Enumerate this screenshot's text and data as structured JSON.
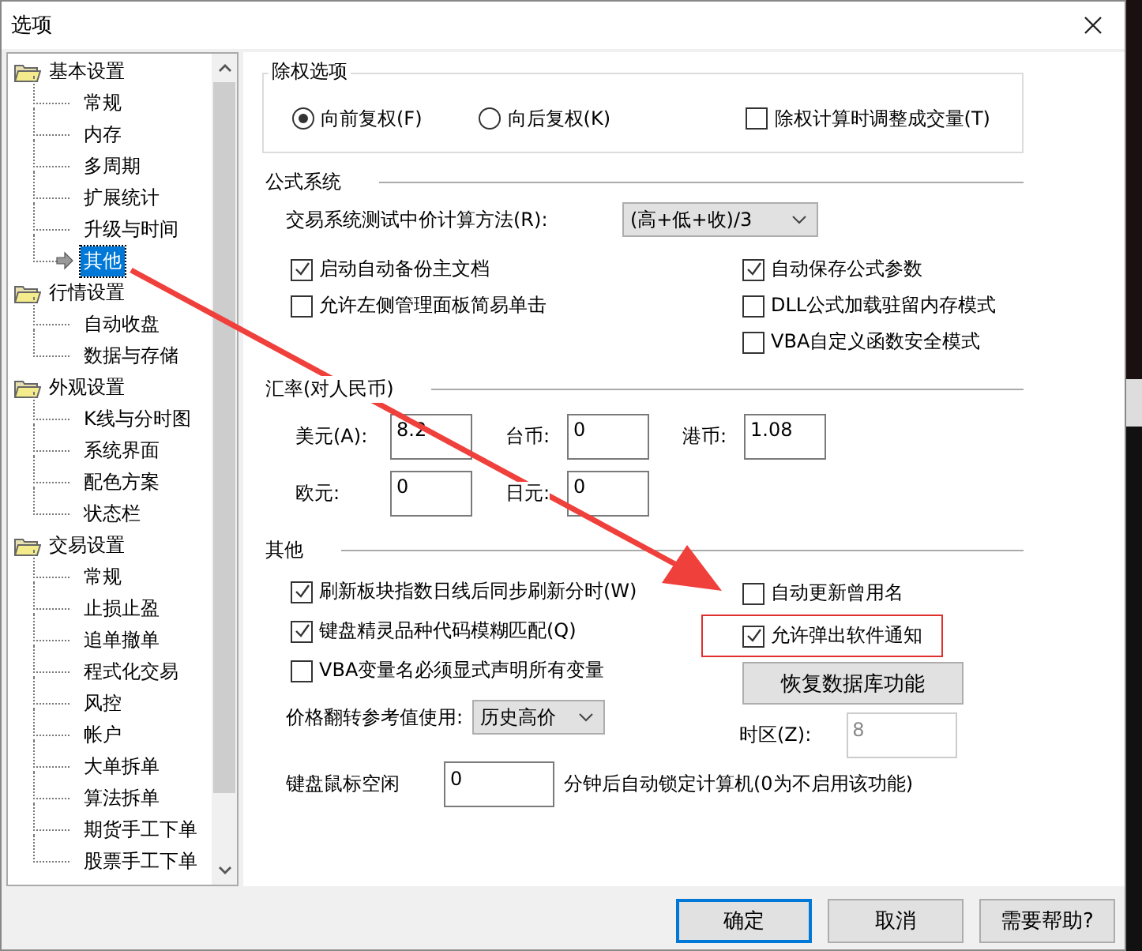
{
  "window": {
    "title": "选项"
  },
  "tree": [
    {
      "label": "基本设置",
      "expanded": true,
      "children": [
        {
          "label": "常规",
          "selected": false
        },
        {
          "label": "内存",
          "selected": false
        },
        {
          "label": "多周期",
          "selected": false
        },
        {
          "label": "扩展统计",
          "selected": false
        },
        {
          "label": "升级与时间",
          "selected": false
        },
        {
          "label": "其他",
          "selected": true
        }
      ]
    },
    {
      "label": "行情设置",
      "expanded": true,
      "children": [
        {
          "label": "自动收盘",
          "selected": false
        },
        {
          "label": "数据与存储",
          "selected": false
        }
      ]
    },
    {
      "label": "外观设置",
      "expanded": true,
      "children": [
        {
          "label": "K线与分时图",
          "selected": false
        },
        {
          "label": "系统界面",
          "selected": false
        },
        {
          "label": "配色方案",
          "selected": false
        },
        {
          "label": "状态栏",
          "selected": false
        }
      ]
    },
    {
      "label": "交易设置",
      "expanded": true,
      "children": [
        {
          "label": "常规",
          "selected": false
        },
        {
          "label": "止损止盈",
          "selected": false
        },
        {
          "label": "追单撤单",
          "selected": false
        },
        {
          "label": "程式化交易",
          "selected": false
        },
        {
          "label": "风控",
          "selected": false
        },
        {
          "label": "帐户",
          "selected": false
        },
        {
          "label": "大单拆单",
          "selected": false
        },
        {
          "label": "算法拆单",
          "selected": false
        },
        {
          "label": "期货手工下单",
          "selected": false
        },
        {
          "label": "股票手工下单",
          "selected": false
        }
      ]
    }
  ],
  "exright": {
    "title": "除权选项",
    "options": [
      {
        "kind": "radio",
        "label": "向前复权(F)",
        "checked": true
      },
      {
        "kind": "radio",
        "label": "向后复权(K)",
        "checked": false
      },
      {
        "kind": "checkbox",
        "label": "除权计算时调整成交量(T)",
        "checked": false
      }
    ]
  },
  "formula": {
    "title": "公式系统",
    "method_label": "交易系统测试中价计算方法(R):",
    "method_value": "(高+低+收)/3",
    "left": [
      {
        "label": "启动自动备份主文档",
        "checked": true
      },
      {
        "label": "允许左侧管理面板简易单击",
        "checked": false
      }
    ],
    "right": [
      {
        "label": "自动保存公式参数",
        "checked": true
      },
      {
        "label": "DLL公式加载驻留内存模式",
        "checked": false
      },
      {
        "label": "VBA自定义函数安全模式",
        "checked": false
      }
    ]
  },
  "rates": {
    "title": "汇率(对人民币)",
    "rows": [
      [
        {
          "label": "美元(A):",
          "value": "8.2"
        },
        {
          "label": "台币:",
          "value": "0"
        },
        {
          "label": "港币:",
          "value": "1.08"
        }
      ],
      [
        {
          "label": "欧元:",
          "value": "0"
        },
        {
          "label": "日元:",
          "value": "0"
        }
      ]
    ]
  },
  "other": {
    "title": "其他",
    "left": [
      {
        "label": "刷新板块指数日线后同步刷新分时(W)",
        "checked": true
      },
      {
        "label": "键盘精灵品种代码模糊匹配(Q)",
        "checked": true
      },
      {
        "label": "VBA变量名必须显式声明所有变量",
        "checked": false
      }
    ],
    "right": [
      {
        "label": "自动更新曾用名",
        "checked": false,
        "highlighted": false
      },
      {
        "label": "允许弹出软件通知",
        "checked": true,
        "highlighted": true
      }
    ],
    "restore_button": "恢复数据库功能",
    "flip_label": "价格翻转参考值使用:",
    "flip_value": "历史高价",
    "tz_label": "时区(Z):",
    "tz_value": "8",
    "tz_disabled": true,
    "idle_label": "键盘鼠标空闲",
    "idle_value": "0",
    "idle_suffix": "分钟后自动锁定计算机(0为不启用该功能)"
  },
  "buttons": [
    {
      "label": "确定",
      "default": true
    },
    {
      "label": "取消",
      "default": false
    },
    {
      "label": "需要帮助?",
      "default": false
    }
  ]
}
